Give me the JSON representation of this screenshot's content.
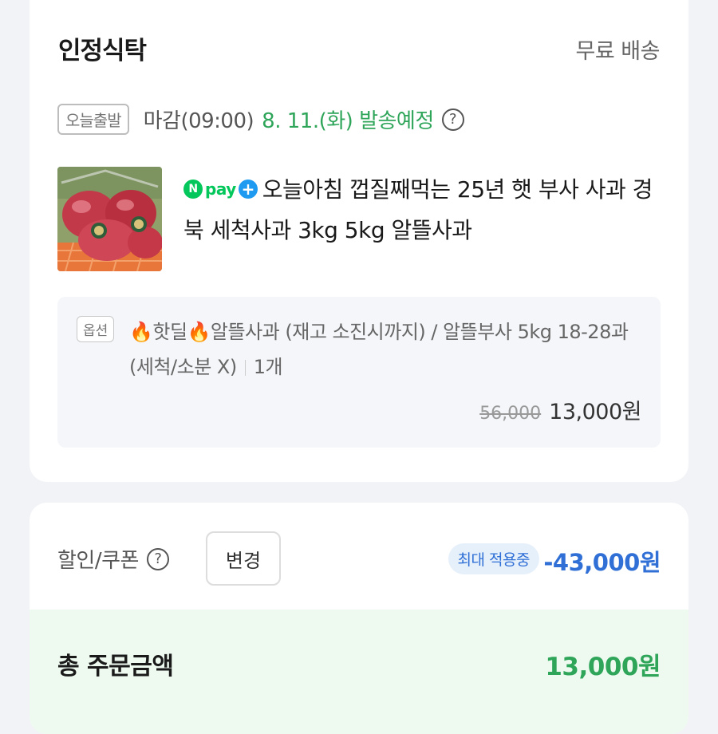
{
  "shop": {
    "name": "인정식탁",
    "shipping_fee": "무료 배송"
  },
  "shipping": {
    "badge": "오늘출발",
    "deadline": "마감(09:00)",
    "date": "8. 11.(화) 발송예정",
    "help_icon": "question-circle-icon"
  },
  "product": {
    "npay_badge": {
      "n": "N",
      "text": "pay",
      "plus": "+"
    },
    "title": "오늘아침 껍질째먹는 25년 햇 부사 사과 경북 세척사과 3kg 5kg 알뜰사과"
  },
  "option": {
    "badge": "옵션",
    "text": "🔥핫딜🔥알뜰사과 (재고 소진시까지) / 알뜰부사 5kg 18-28과(세척/소분 X)",
    "quantity": "1개",
    "original_price": "56,000",
    "sale_price": "13,000원"
  },
  "discount": {
    "label": "할인/쿠폰",
    "change_button": "변경",
    "max_badge": "최대 적용중",
    "amount": "-43,000원"
  },
  "total": {
    "label": "총 주문금액",
    "amount": "13,000원"
  },
  "colors": {
    "green": "#2fa55a",
    "blue": "#2f6fd6",
    "npay_green": "#03c75a"
  }
}
